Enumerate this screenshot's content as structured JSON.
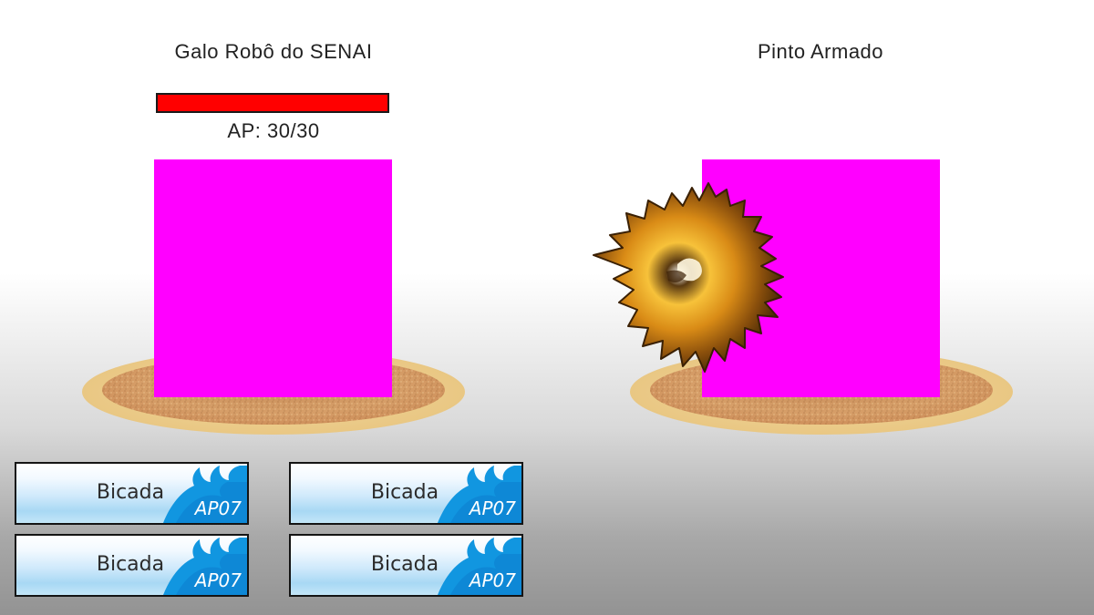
{
  "player": {
    "name": "Galo Robô do SENAI",
    "ap_text": "AP: 30/30",
    "hp_fraction": 1.0,
    "hp_color": "#ff0000",
    "sprite_color": "#ff00ff"
  },
  "enemy": {
    "name": "Pinto Armado",
    "sprite_color": "#ff00ff"
  },
  "effect": {
    "icon": "explosion-icon"
  },
  "skills": [
    {
      "label": "Bicada",
      "cost": "AP07"
    },
    {
      "label": "Bicada",
      "cost": "AP07"
    },
    {
      "label": "Bicada",
      "cost": "AP07"
    },
    {
      "label": "Bicada",
      "cost": "AP07"
    }
  ]
}
